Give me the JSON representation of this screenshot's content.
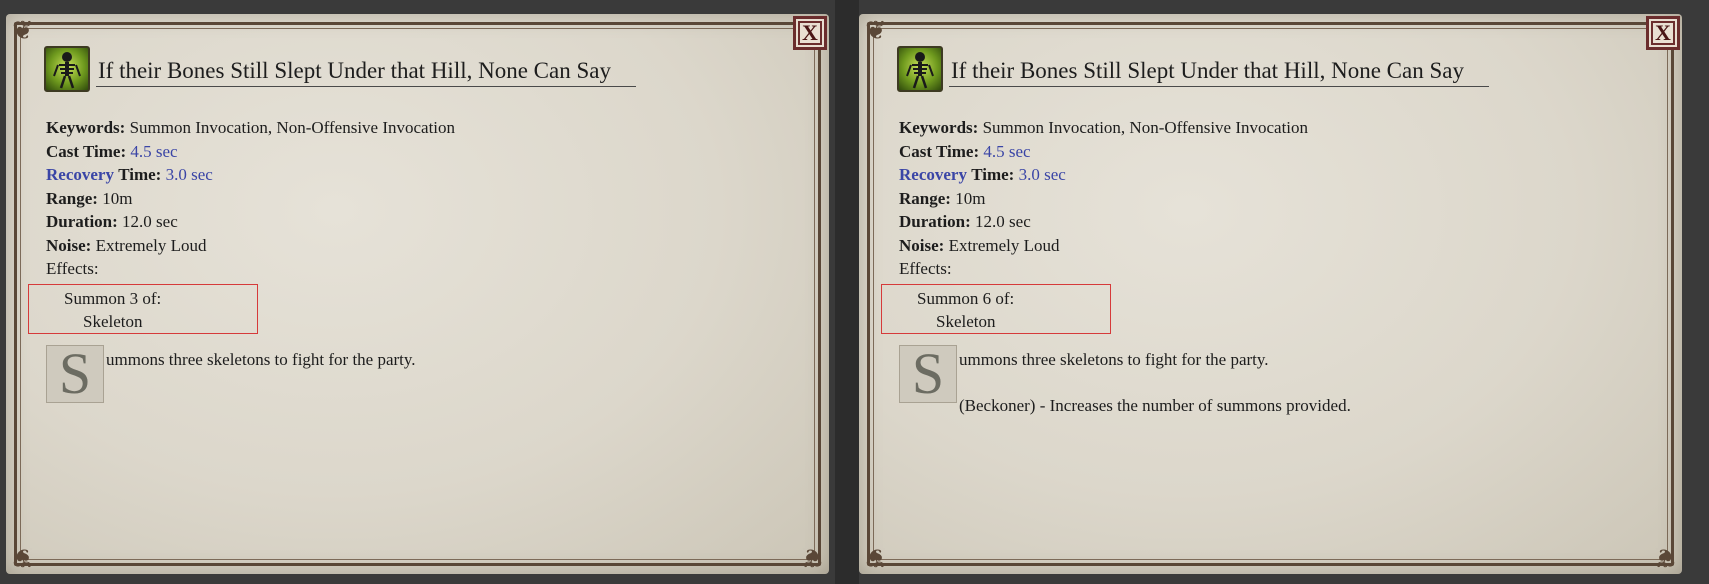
{
  "panels": [
    {
      "title": "If their Bones Still Slept Under that Hill, None Can Say",
      "close_label": "X",
      "props": {
        "keywords_label": "Keywords:",
        "keywords_value": "Summon Invocation, Non-Offensive Invocation",
        "cast_label": "Cast Time:",
        "cast_value": "4.5 sec",
        "recovery_label_a": "Recovery",
        "recovery_label_b": "Time:",
        "recovery_value": "3.0 sec",
        "range_label": "Range:",
        "range_value": "10m",
        "duration_label": "Duration:",
        "duration_value": "12.0 sec",
        "noise_label": "Noise:",
        "noise_value": "Extremely Loud",
        "effects_label": "Effects:"
      },
      "effect_line1": "Summon 3 of:",
      "effect_line2": "Skeleton",
      "dropcap": "S",
      "description": "ummons three skeletons to fight for the party.",
      "extra": ""
    },
    {
      "title": "If their Bones Still Slept Under that Hill, None Can Say",
      "close_label": "X",
      "props": {
        "keywords_label": "Keywords:",
        "keywords_value": "Summon Invocation, Non-Offensive Invocation",
        "cast_label": "Cast Time:",
        "cast_value": "4.5 sec",
        "recovery_label_a": "Recovery",
        "recovery_label_b": "Time:",
        "recovery_value": "3.0 sec",
        "range_label": "Range:",
        "range_value": "10m",
        "duration_label": "Duration:",
        "duration_value": "12.0 sec",
        "noise_label": "Noise:",
        "noise_value": "Extremely Loud",
        "effects_label": "Effects:"
      },
      "effect_line1": "Summon 6 of:",
      "effect_line2": "Skeleton",
      "dropcap": "S",
      "description": "ummons three skeletons to fight for the party.",
      "extra": "(Beckoner) - Increases the number of summons provided."
    }
  ],
  "colors": {
    "accent_blue": "#3a45a6",
    "highlight_red": "#d63a3a",
    "close_red": "#6b2d2d"
  },
  "icons": {
    "ability": "skeleton-summon-icon",
    "close": "close-icon",
    "dropcap": "illuminated-letter"
  }
}
